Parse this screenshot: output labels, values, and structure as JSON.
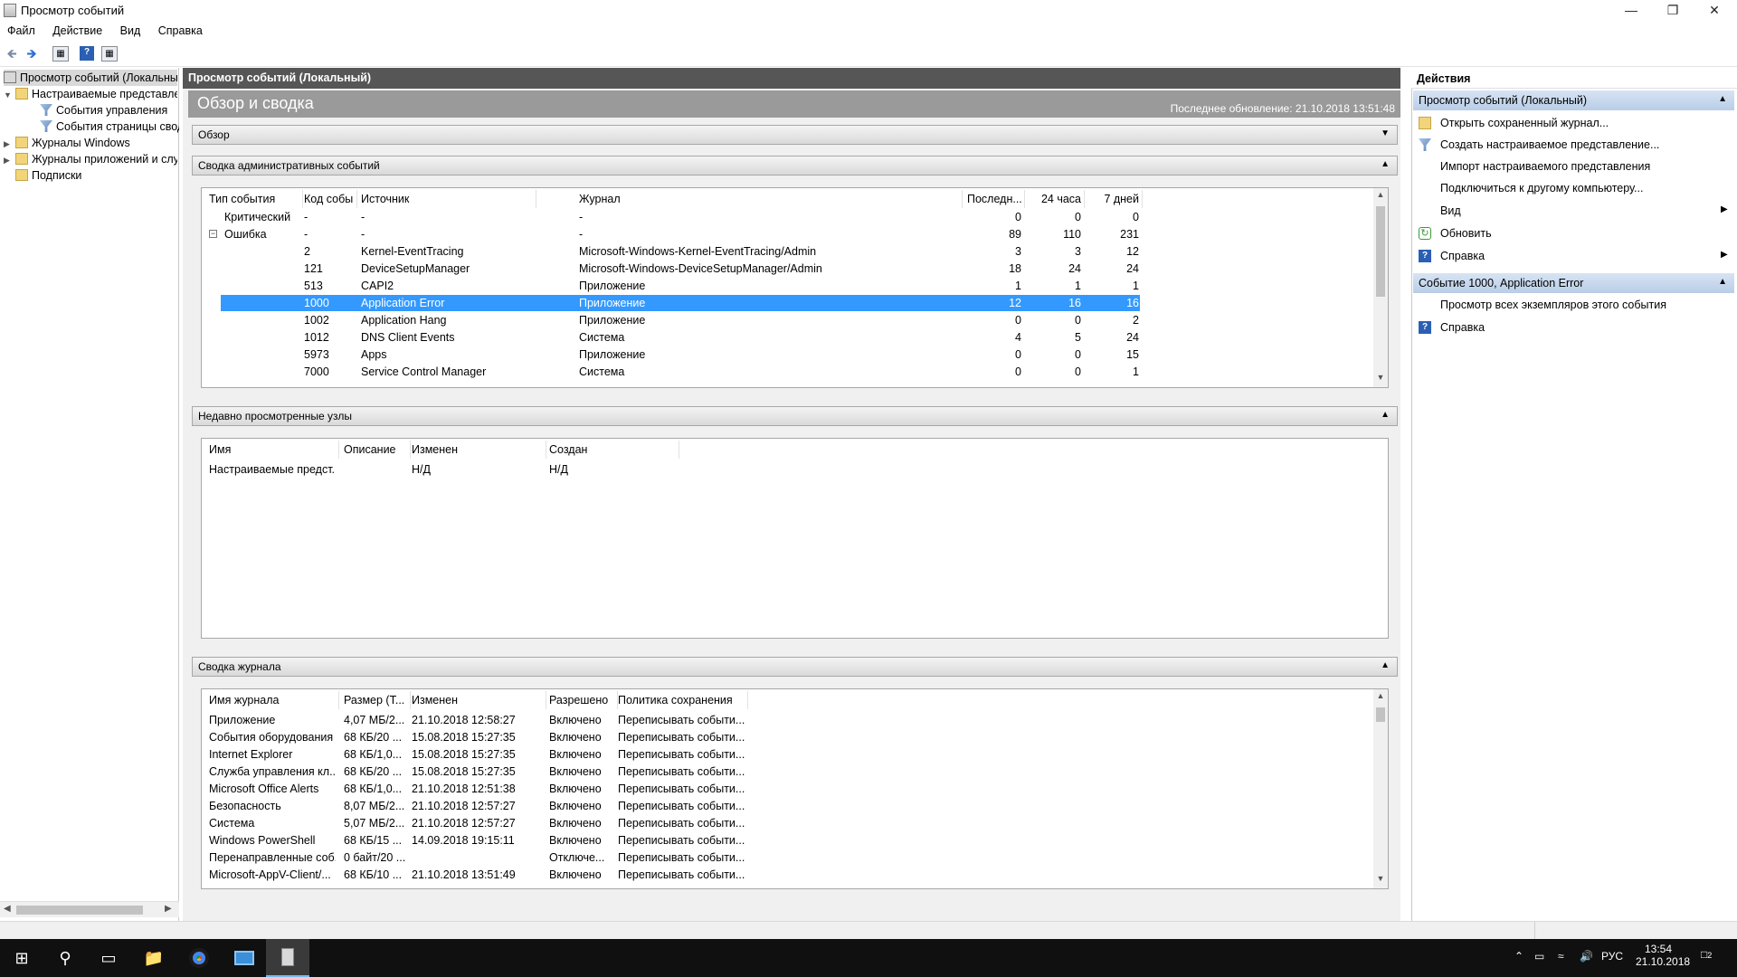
{
  "window": {
    "title": "Просмотр событий"
  },
  "menu": [
    "Файл",
    "Действие",
    "Вид",
    "Справка"
  ],
  "tree": {
    "root": "Просмотр событий (Локальный)",
    "custom_views": "Настраиваемые представления",
    "admin_events": "События управления",
    "summary_page_events": "События страницы сводки",
    "windows_logs": "Журналы Windows",
    "app_logs": "Журналы приложений и служб",
    "subscriptions": "Подписки"
  },
  "center": {
    "header": "Просмотр событий (Локальный)",
    "overview_title": "Обзор и сводка",
    "last_update": "Последнее обновление: 21.10.2018 13:51:48",
    "sections": {
      "overview": "Обзор",
      "admin_summary": "Сводка административных событий",
      "recent_nodes": "Недавно просмотренные узлы",
      "log_summary": "Сводка журнала"
    },
    "admin_columns": [
      "Тип события",
      "Код собы...",
      "Источник",
      "Журнал",
      "Последн...",
      "24 часа",
      "7 дней"
    ],
    "admin_rows": [
      {
        "type": "Критический",
        "code": "-",
        "source": "-",
        "log": "-",
        "last": "0",
        "h24": "0",
        "d7": "0"
      },
      {
        "type": "Ошибка",
        "code": "-",
        "source": "-",
        "log": "-",
        "last": "89",
        "h24": "110",
        "d7": "231"
      },
      {
        "type": "",
        "code": "2",
        "source": "Kernel-EventTracing",
        "log": "Microsoft-Windows-Kernel-EventTracing/Admin",
        "last": "3",
        "h24": "3",
        "d7": "12"
      },
      {
        "type": "",
        "code": "121",
        "source": "DeviceSetupManager",
        "log": "Microsoft-Windows-DeviceSetupManager/Admin",
        "last": "18",
        "h24": "24",
        "d7": "24"
      },
      {
        "type": "",
        "code": "513",
        "source": "CAPI2",
        "log": "Приложение",
        "last": "1",
        "h24": "1",
        "d7": "1"
      },
      {
        "type": "",
        "code": "1000",
        "source": "Application Error",
        "log": "Приложение",
        "last": "12",
        "h24": "16",
        "d7": "16"
      },
      {
        "type": "",
        "code": "1002",
        "source": "Application Hang",
        "log": "Приложение",
        "last": "0",
        "h24": "0",
        "d7": "2"
      },
      {
        "type": "",
        "code": "1012",
        "source": "DNS Client Events",
        "log": "Система",
        "last": "4",
        "h24": "5",
        "d7": "24"
      },
      {
        "type": "",
        "code": "5973",
        "source": "Apps",
        "log": "Приложение",
        "last": "0",
        "h24": "0",
        "d7": "15"
      },
      {
        "type": "",
        "code": "7000",
        "source": "Service Control Manager",
        "log": "Система",
        "last": "0",
        "h24": "0",
        "d7": "1"
      }
    ],
    "recent_columns": [
      "Имя",
      "Описание",
      "Изменен",
      "Создан"
    ],
    "recent_rows": [
      {
        "name": "Настраиваемые предст...",
        "desc": "",
        "modified": "Н/Д",
        "created": "Н/Д"
      }
    ],
    "log_columns": [
      "Имя журнала",
      "Размер (Т...",
      "Изменен",
      "Разрешено",
      "Политика сохранения"
    ],
    "log_rows": [
      {
        "name": "Приложение",
        "size": "4,07 МБ/2...",
        "modified": "21.10.2018 12:58:27",
        "enabled": "Включено",
        "policy": "Переписывать событи..."
      },
      {
        "name": "События оборудования",
        "size": "68 КБ/20 ...",
        "modified": "15.08.2018 15:27:35",
        "enabled": "Включено",
        "policy": "Переписывать событи..."
      },
      {
        "name": "Internet Explorer",
        "size": "68 КБ/1,0...",
        "modified": "15.08.2018 15:27:35",
        "enabled": "Включено",
        "policy": "Переписывать событи..."
      },
      {
        "name": "Служба управления кл...",
        "size": "68 КБ/20 ...",
        "modified": "15.08.2018 15:27:35",
        "enabled": "Включено",
        "policy": "Переписывать событи..."
      },
      {
        "name": "Microsoft Office Alerts",
        "size": "68 КБ/1,0...",
        "modified": "21.10.2018 12:51:38",
        "enabled": "Включено",
        "policy": "Переписывать событи..."
      },
      {
        "name": "Безопасность",
        "size": "8,07 МБ/2...",
        "modified": "21.10.2018 12:57:27",
        "enabled": "Включено",
        "policy": "Переписывать событи..."
      },
      {
        "name": "Система",
        "size": "5,07 МБ/2...",
        "modified": "21.10.2018 12:57:27",
        "enabled": "Включено",
        "policy": "Переписывать событи..."
      },
      {
        "name": "Windows PowerShell",
        "size": "68 КБ/15 ...",
        "modified": "14.09.2018 19:15:11",
        "enabled": "Включено",
        "policy": "Переписывать событи..."
      },
      {
        "name": "Перенаправленные соб...",
        "size": "0 байт/20 ...",
        "modified": "",
        "enabled": "Отключе...",
        "policy": "Переписывать событи..."
      },
      {
        "name": "Microsoft-AppV-Client/...",
        "size": "68 КБ/10 ...",
        "modified": "21.10.2018 13:51:49",
        "enabled": "Включено",
        "policy": "Переписывать событи..."
      }
    ]
  },
  "actions": {
    "header": "Действия",
    "section1": "Просмотр событий (Локальный)",
    "items1": [
      "Открыть сохраненный журнал...",
      "Создать настраиваемое представление...",
      "Импорт настраиваемого представления",
      "Подключиться к другому компьютеру...",
      "Вид",
      "Обновить",
      "Справка"
    ],
    "section2": "Событие 1000, Application Error",
    "items2": [
      "Просмотр всех экземпляров этого события",
      "Справка"
    ]
  },
  "taskbar": {
    "lang": "РУС",
    "time": "13:54",
    "date": "21.10.2018",
    "notif_count": "2"
  },
  "colors": {
    "selection": "#3399ff",
    "header_bg": "#565656",
    "action_section": "#c6d7ee"
  }
}
